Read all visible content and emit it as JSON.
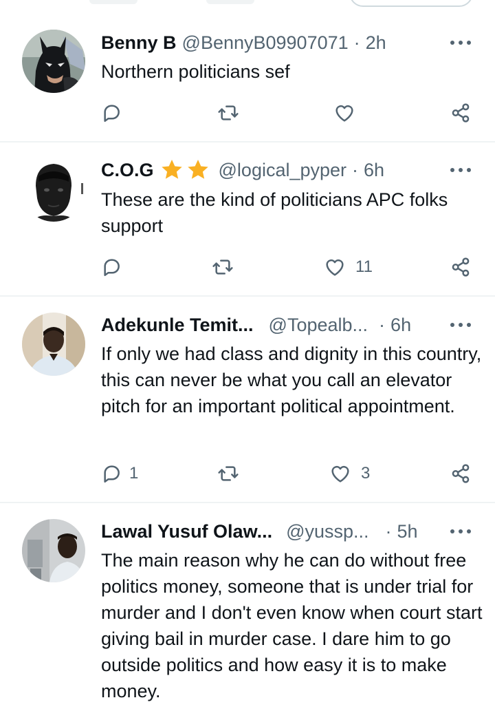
{
  "replies": [
    {
      "name": "Benny B",
      "handle": "@BennyB09907071",
      "separator": "·",
      "time": "2h",
      "stars": 0,
      "text": "Northern politicians sef",
      "reply_count": "",
      "like_count": "",
      "avatar_icon": "batman-avatar"
    },
    {
      "name": "C.O.G",
      "handle": "@logical_pyper",
      "separator": "·",
      "time": "6h",
      "stars": 2,
      "text": "These are the kind of politicians APC folks support",
      "reply_count": "",
      "like_count": "11",
      "avatar_icon": "portrait-avatar"
    },
    {
      "name": "Adekunle Temit...",
      "handle": "@Topealb...",
      "separator": "·",
      "time": "6h",
      "stars": 0,
      "text": "If only we had class and dignity in this country, this can never be what you call an elevator pitch for an important political appointment.",
      "reply_count": "1",
      "like_count": "3",
      "avatar_icon": "photo-avatar"
    },
    {
      "name": "Lawal Yusuf Olaw...",
      "handle": "@yussp...",
      "separator": "·",
      "time": "5h",
      "stars": 0,
      "text": "The main reason why he can do without free politics money, someone that is under trial for murder and I don't even know when court start giving bail in murder case. I dare him to go outside politics and how easy it is to make money.",
      "reply_count": "",
      "like_count": "",
      "avatar_icon": "photo-avatar"
    }
  ],
  "colors": {
    "text": "#0f1419",
    "secondary": "#536471",
    "divider": "#eff3f4",
    "star": "#f9b023"
  },
  "icons": {
    "reply": "reply-icon",
    "repost": "repost-icon",
    "like": "heart-icon",
    "share": "share-icon",
    "more": "more-icon",
    "star": "star-icon"
  }
}
